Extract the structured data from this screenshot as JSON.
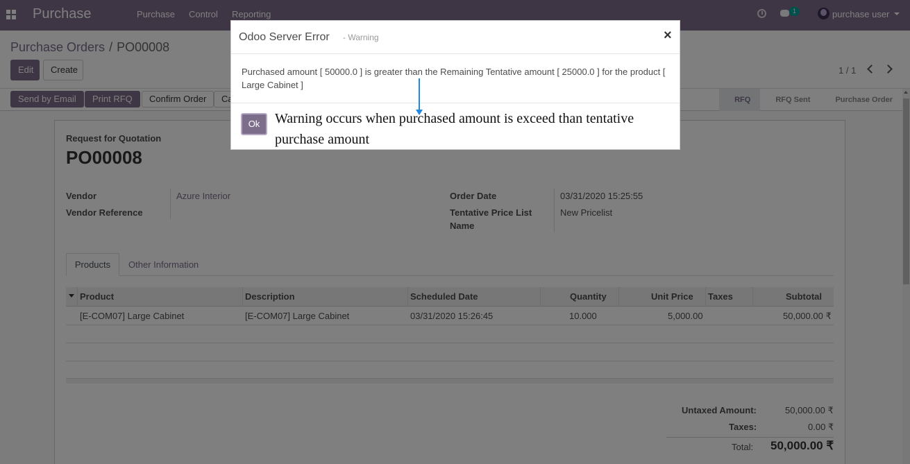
{
  "navbar": {
    "brand": "Purchase",
    "menu": [
      "Purchase",
      "Control",
      "Reporting"
    ],
    "chat_count": "1",
    "user": "purchase user"
  },
  "control_panel": {
    "breadcrumb_parent": "Purchase Orders",
    "breadcrumb_sep": "/",
    "breadcrumb_current": "PO00008",
    "edit_label": "Edit",
    "create_label": "Create",
    "pager": "1 / 1"
  },
  "header_buttons": {
    "send_email": "Send by Email",
    "print_rfq": "Print RFQ",
    "confirm_order": "Confirm Order",
    "cancel_partial": "Ca"
  },
  "statusbar": [
    "RFQ",
    "RFQ Sent",
    "Purchase Order"
  ],
  "form": {
    "doc_type": "Request for Quotation",
    "name": "PO00008",
    "vendor_label": "Vendor",
    "vendor_value": "Azure Interior",
    "vendor_ref_label": "Vendor Reference",
    "order_date_label": "Order Date",
    "order_date_value": "03/31/2020 15:25:55",
    "pricelist_label_1": "Tentative Price List",
    "pricelist_label_2": "Name",
    "pricelist_value": "New Pricelist"
  },
  "tabs": [
    "Products",
    "Other Information"
  ],
  "table": {
    "headers": [
      "Product",
      "Description",
      "Scheduled Date",
      "Quantity",
      "Unit Price",
      "Taxes",
      "Subtotal"
    ],
    "rows": [
      [
        "[E-COM07] Large Cabinet",
        "[E-COM07] Large Cabinet",
        "03/31/2020 15:26:45",
        "10.000",
        "5,000.00",
        "",
        "50,000.00 ₹"
      ]
    ]
  },
  "totals": {
    "untaxed_label": "Untaxed Amount:",
    "untaxed_value": "50,000.00 ₹",
    "taxes_label": "Taxes:",
    "taxes_value": "0.00 ₹",
    "total_label": "Total:",
    "total_value": "50,000.00 ₹"
  },
  "modal": {
    "title": "Odoo Server Error",
    "subtitle": "- Warning",
    "close": "×",
    "message": "Purchased amount [ 50000.0 ] is greater than the Remaining Tentative amount [ 25000.0 ] for the product [ Large Cabinet ]",
    "ok_label": "Ok",
    "annotation": "Warning occurs when purchased amount is exceed than tentative purchase amount"
  },
  "colors": {
    "brand": "#7c6d8b",
    "annotation_arrow": "#1e88e5"
  }
}
